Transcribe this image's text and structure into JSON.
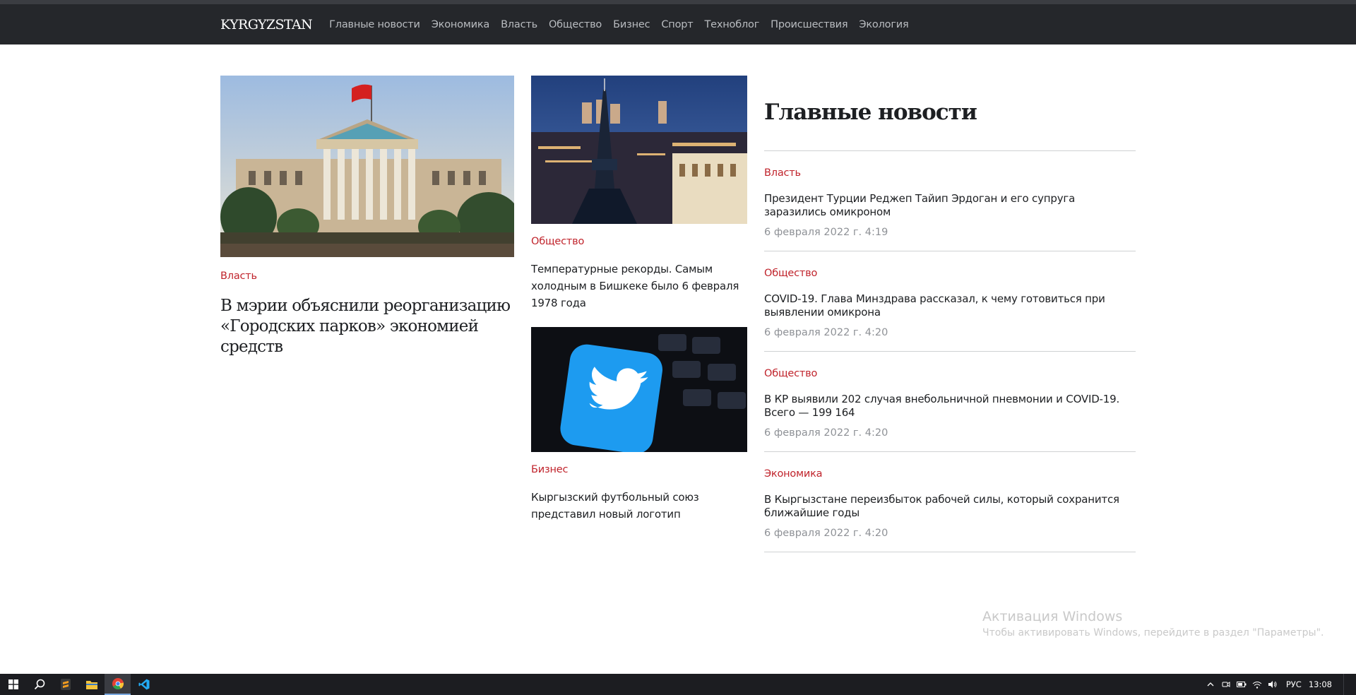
{
  "header": {
    "brand": "KYRGYZSTAN",
    "nav": [
      "Главные новости",
      "Экономика",
      "Власть",
      "Общество",
      "Бизнес",
      "Спорт",
      "Техноблог",
      "Происшествия",
      "Экология"
    ]
  },
  "main_story": {
    "category": "Власть",
    "title": "В мэрии объяснили реорганизацию «Городских парков» экономией средств"
  },
  "mid_stories": [
    {
      "category": "Общество",
      "title": "Температурные рекорды. Самым холодным в Бишкеке было 6 февраля 1978 года"
    },
    {
      "category": "Бизнес",
      "title": "Кыргызский футбольный союз представил новый логотип"
    }
  ],
  "sidebar": {
    "heading": "Главные новости",
    "items": [
      {
        "category": "Власть",
        "title": "Президент Турции Реджеп Тайип Эрдоган и его супруга заразились омикроном",
        "date": "6 февраля 2022 г. 4:19"
      },
      {
        "category": "Общество",
        "title": "COVID-19. Глава Минздрава рассказал, к чему готовиться при выявлении омикрона",
        "date": "6 февраля 2022 г. 4:20"
      },
      {
        "category": "Общество",
        "title": "В КР выявили 202 случая внебольничной пневмонии и COVID-19. Всего — 199 164",
        "date": "6 февраля 2022 г. 4:20"
      },
      {
        "category": "Экономика",
        "title": "В Кыргызстане переизбыток рабочей силы, который сохранится ближайшие годы",
        "date": "6 февраля 2022 г. 4:20"
      }
    ]
  },
  "watermark": {
    "title": "Активация Windows",
    "subtitle": "Чтобы активировать Windows, перейдите в раздел \"Параметры\"."
  },
  "taskbar": {
    "lang": "РУС",
    "time": "13:08",
    "apps": [
      "start-icon",
      "search-icon",
      "sublime-icon",
      "file-explorer-icon",
      "chrome-icon",
      "vscode-icon"
    ]
  },
  "colors": {
    "accent": "#c0232b",
    "header_bg": "#25272b",
    "text": "#1d1f22",
    "muted": "#8e9196"
  }
}
